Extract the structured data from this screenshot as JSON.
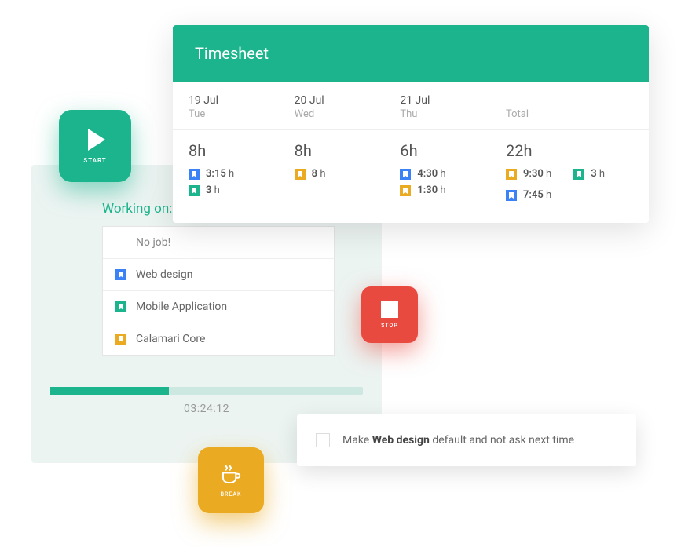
{
  "colors": {
    "green": "#1bb48c",
    "blue": "#3b82f6",
    "yellow": "#eaaa21",
    "red": "#e84a3f"
  },
  "timesheet": {
    "title": "Timesheet",
    "columns": [
      {
        "date": "19 Jul",
        "day": "Tue",
        "hours": "8h",
        "entries": [
          {
            "color": "blue",
            "val": "3:15",
            "unit": "h"
          },
          {
            "color": "green",
            "val": "3",
            "unit": "h"
          }
        ]
      },
      {
        "date": "20 Jul",
        "day": "Wed",
        "hours": "8h",
        "entries": [
          {
            "color": "yellow",
            "val": "8",
            "unit": "h"
          }
        ]
      },
      {
        "date": "21 Jul",
        "day": "Thu",
        "hours": "6h",
        "entries": [
          {
            "color": "blue",
            "val": "4:30",
            "unit": "h"
          },
          {
            "color": "yellow",
            "val": "1:30",
            "unit": "h"
          }
        ]
      }
    ],
    "total": {
      "label": "Total",
      "hours": "22h",
      "entries": [
        [
          {
            "color": "yellow",
            "val": "9:30",
            "unit": "h"
          },
          {
            "color": "blue",
            "val": "7:45",
            "unit": "h"
          }
        ],
        [
          {
            "color": "green",
            "val": "3",
            "unit": "h"
          }
        ]
      ]
    }
  },
  "working": {
    "title": "Working on:",
    "jobs": [
      {
        "nojob": true,
        "label": "No job!"
      },
      {
        "color": "blue",
        "label": "Web design"
      },
      {
        "color": "green",
        "label": "Mobile Application"
      },
      {
        "color": "yellow",
        "label": "Calamari Core"
      }
    ],
    "elapsed": "03:24:12",
    "progress_pct": 38
  },
  "buttons": {
    "start": "START",
    "stop": "STOP",
    "break": "BREAK"
  },
  "default_prompt": {
    "prefix": "Make ",
    "bold": "Web design",
    "suffix": " default and not ask next time"
  }
}
